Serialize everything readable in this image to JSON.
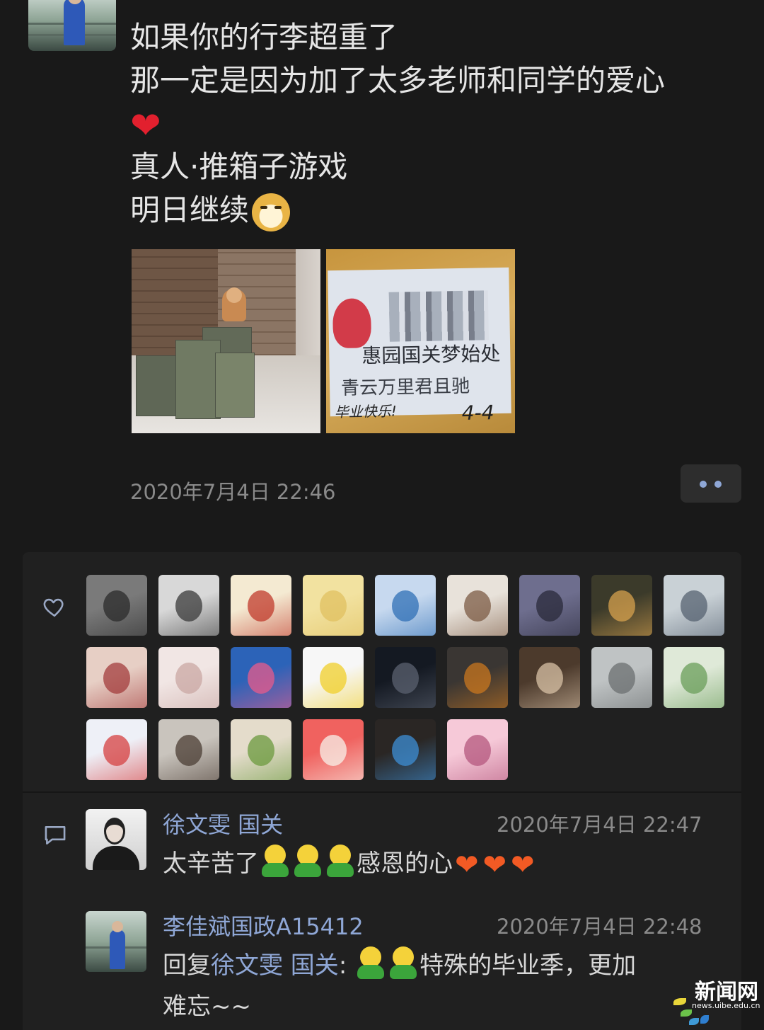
{
  "post": {
    "author_avatar": "poster-avatar",
    "text_lines": [
      "如果你的行李超重了",
      "那一定是因为加了太多老师和同学的爱心",
      "真人·推箱子游戏",
      "明日继续"
    ],
    "emoji": {
      "heart": "❤",
      "dog": "dog-face-emoji"
    },
    "photos": [
      {
        "desc": "luggage-boxes-photo"
      },
      {
        "desc": "graduation-card-photo",
        "card_lines": [
          "惠园国关梦始处",
          "青云万里君且驰"
        ],
        "handwriting": [
          "毕业快乐!",
          "4-4"
        ]
      }
    ],
    "timestamp": "2020年7月4日 22:46"
  },
  "likes": {
    "icon": "heart-outline-icon",
    "count_shown": 25
  },
  "comments": {
    "icon": "comment-bubble-icon",
    "items": [
      {
        "name": "徐文雯 国关",
        "time": "2020年7月4日 22:47",
        "text_before": "太辛苦了",
        "text_after": "感恩的心",
        "smile_count": 3,
        "heart_count": 3
      },
      {
        "name": "李佳斌国政A15412",
        "time": "2020年7月4日 22:48",
        "reply_prefix": "回复",
        "reply_to": "徐文雯 国关",
        "reply_colon": ":",
        "text_line1": "特殊的毕业季，更加",
        "text_line2": "难忘~~",
        "smile_count": 2
      }
    ]
  },
  "watermark": {
    "title": "新闻网",
    "url": "news.uibe.edu.cn"
  },
  "colors": {
    "background": "#191919",
    "panel": "#202020",
    "link_blue": "#8fa7d6",
    "timestamp_gray": "#8a8a8a"
  }
}
